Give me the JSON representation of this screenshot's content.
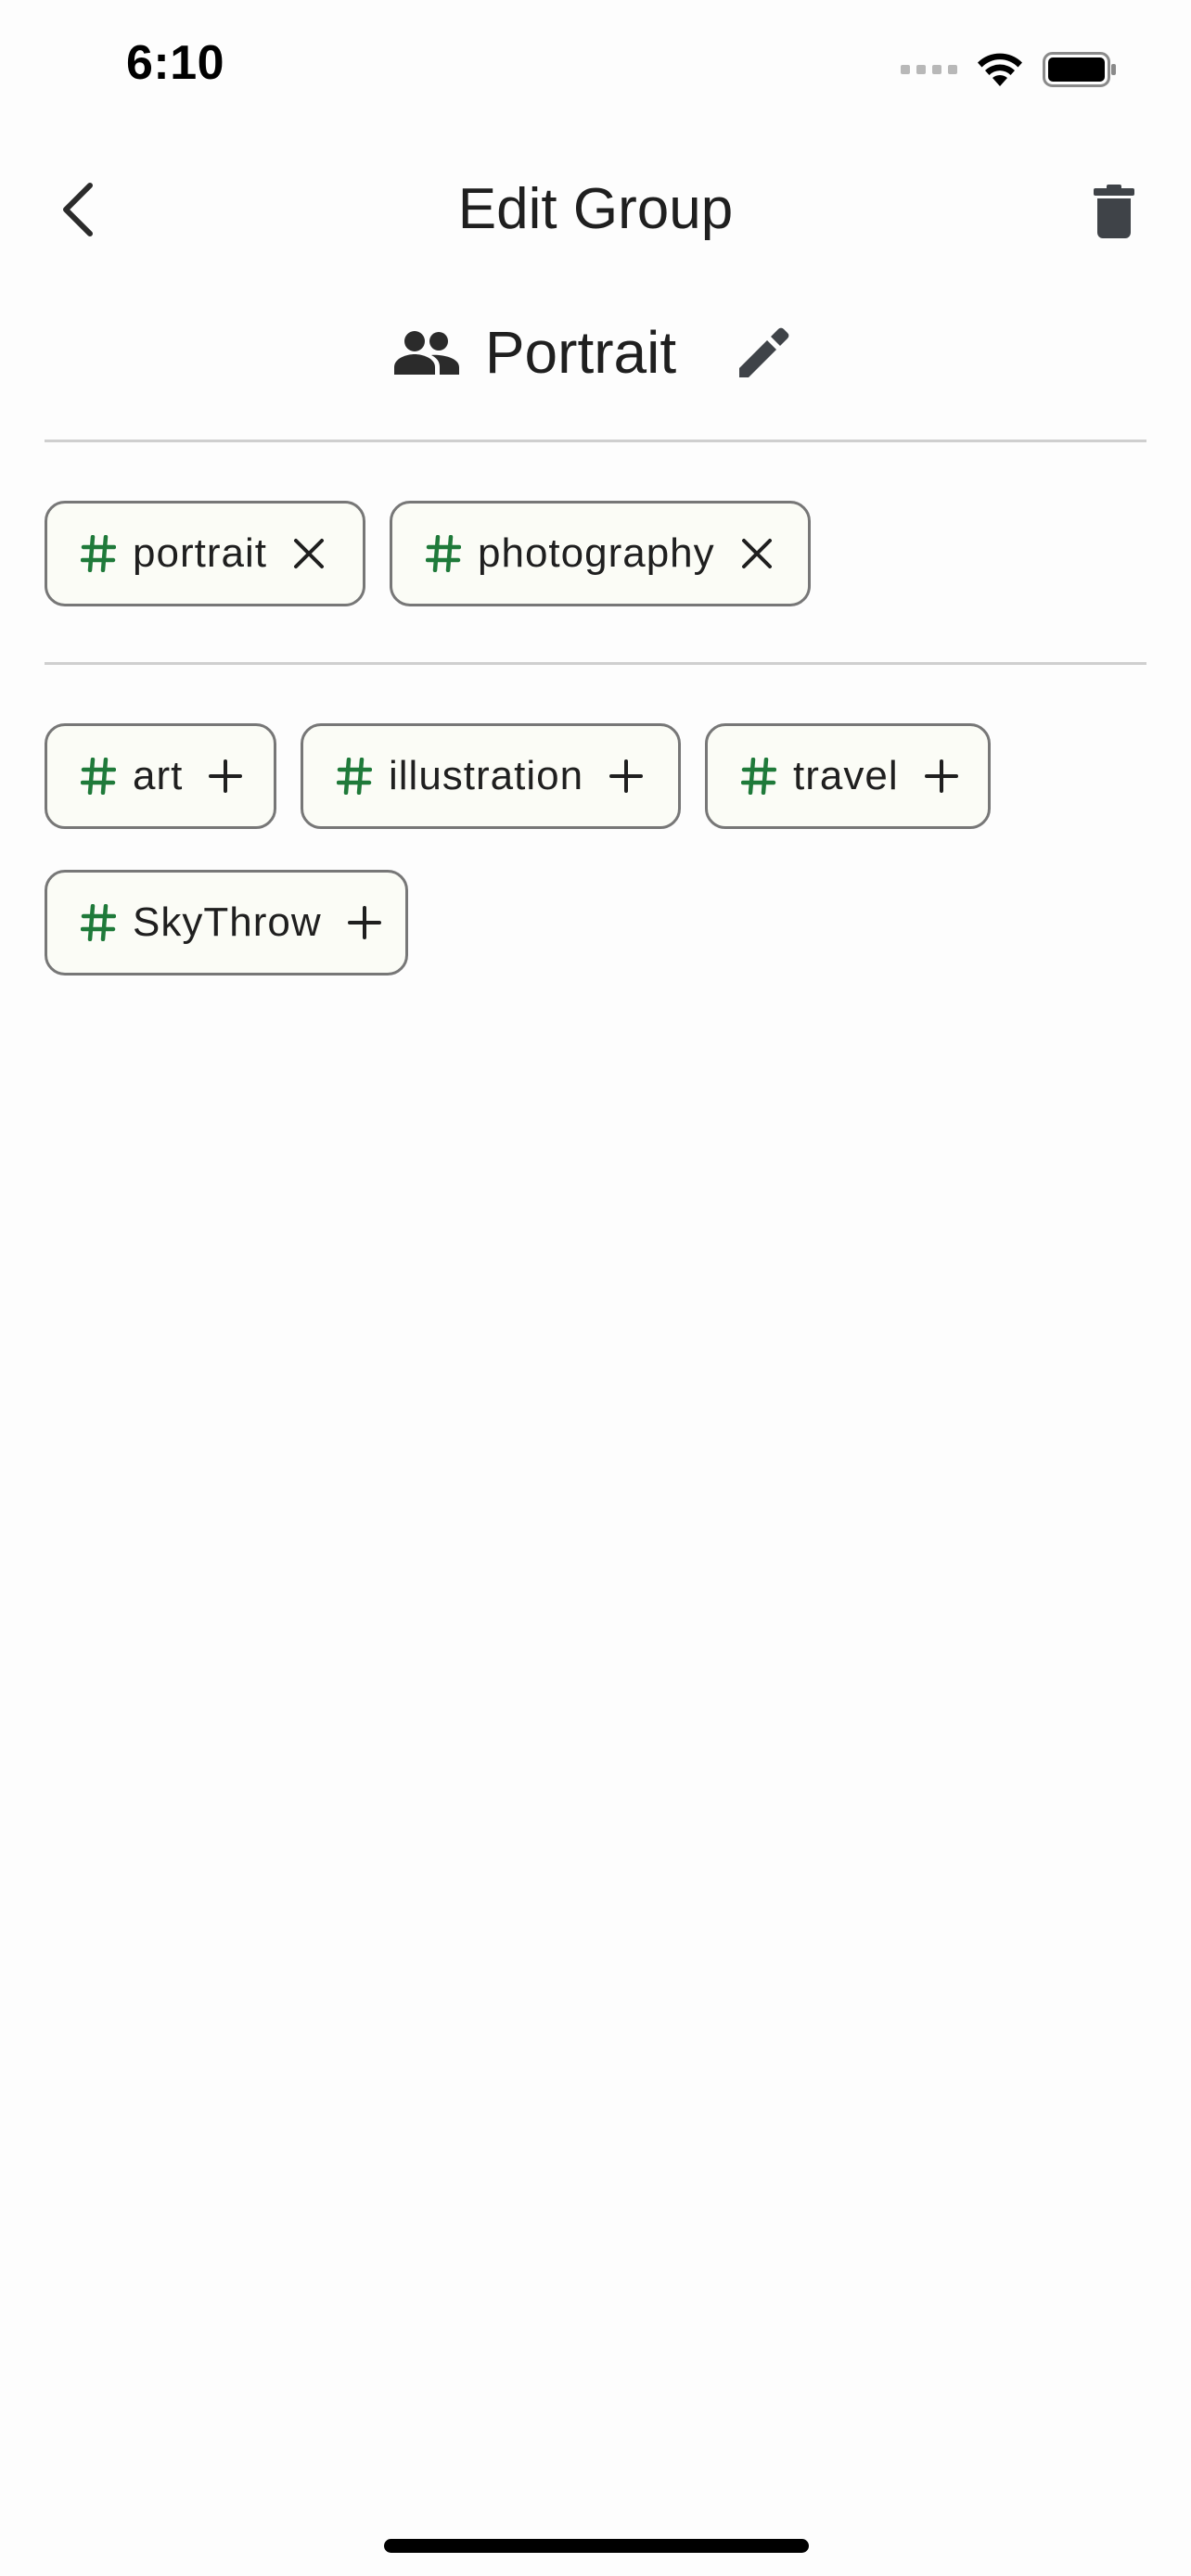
{
  "status_bar": {
    "time": "6:10"
  },
  "nav": {
    "title": "Edit Group"
  },
  "group": {
    "name": "Portrait"
  },
  "selected_tags": [
    {
      "label": "portrait"
    },
    {
      "label": "photography"
    }
  ],
  "available_tags": [
    {
      "label": "art"
    },
    {
      "label": "illustration"
    },
    {
      "label": "travel"
    },
    {
      "label": "SkyThrow"
    }
  ],
  "icons": {
    "back": "chevron-left-icon",
    "delete": "trash-icon",
    "group": "people-icon",
    "edit": "pencil-icon",
    "tag": "hash-icon",
    "remove": "close-icon",
    "add": "plus-icon"
  },
  "colors": {
    "tag_hash": "#1f7a3a",
    "chip_border": "#777777",
    "chip_background": "#fbfcf6",
    "icon_dark": "#3f4348"
  }
}
